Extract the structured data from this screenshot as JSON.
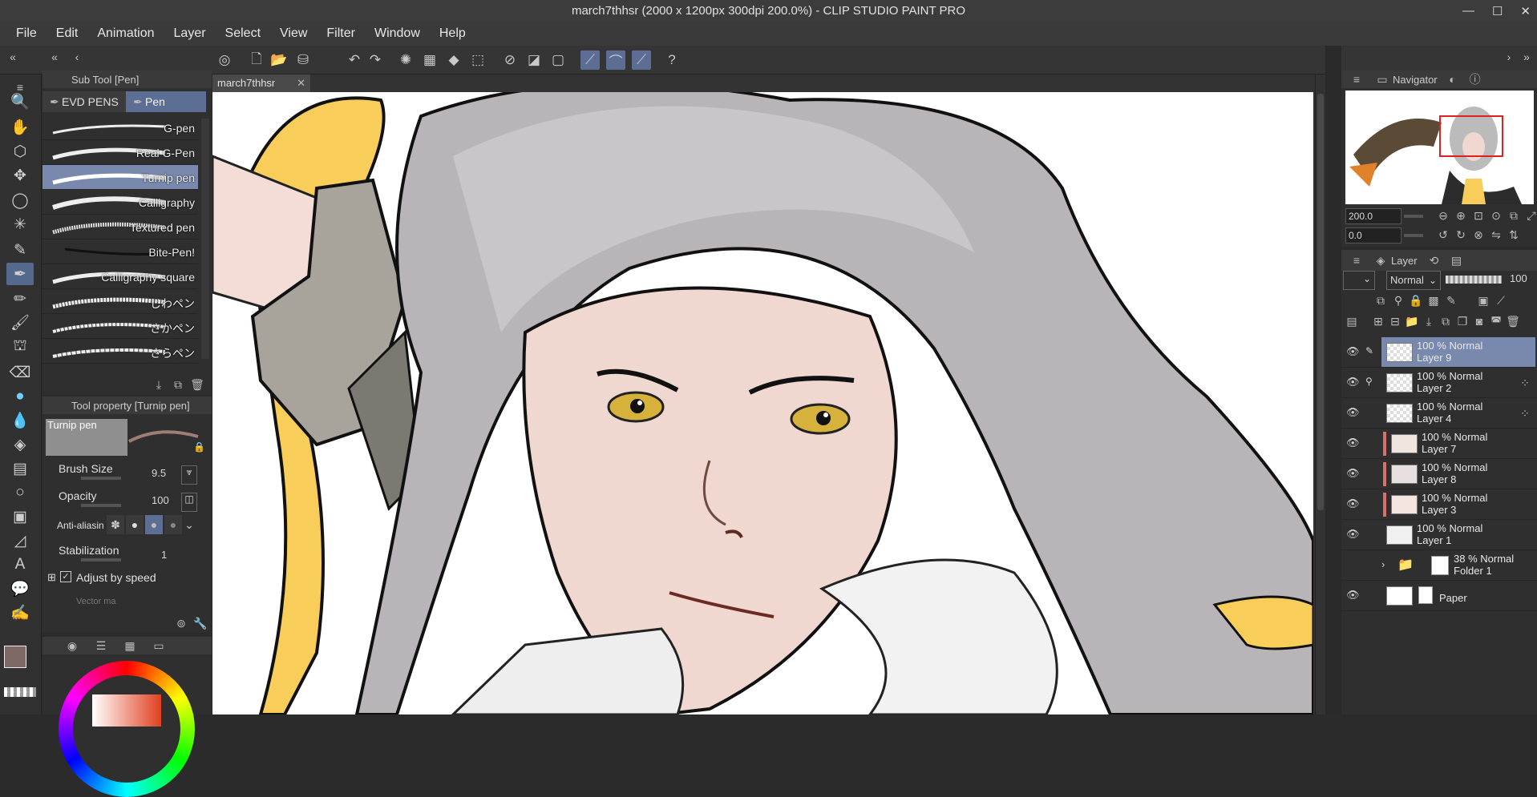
{
  "window": {
    "title": "march7thhsr (2000 x 1200px 300dpi 200.0%)  - CLIP STUDIO PAINT PRO"
  },
  "menu": [
    "File",
    "Edit",
    "Animation",
    "Layer",
    "Select",
    "View",
    "Filter",
    "Window",
    "Help"
  ],
  "document_tab": {
    "label": "march7thhsr"
  },
  "subtool": {
    "header": "Sub Tool [Pen]",
    "tabs": [
      "EVD PENS",
      "Pen"
    ],
    "brushes": [
      "G-pen",
      "Real G-Pen",
      "Turnip pen",
      "Calligraphy",
      "Textured pen",
      "Bite-Pen!",
      "Calligraphy square",
      "じわペン",
      "さかペン",
      "さらペン"
    ],
    "selected_brush": "Turnip pen"
  },
  "tool_property": {
    "header": "Tool property [Turnip pen]",
    "preview_label": "Turnip pen",
    "brush_size_label": "Brush Size",
    "brush_size_value": "9.5",
    "opacity_label": "Opacity",
    "opacity_value": "100",
    "antialias_label": "Anti-aliasin",
    "stabilization_label": "Stabilization",
    "stabilization_value": "1",
    "adjust_speed_label": "Adjust by speed",
    "vector_label": "Vector ma"
  },
  "navigator": {
    "header": "Navigator",
    "zoom_value": "200.0",
    "rotate_value": "0.0"
  },
  "layer_panel": {
    "header": "Layer",
    "blend_mode": "Normal",
    "opacity": "100",
    "layers": [
      {
        "opacity_mode": "100 % Normal",
        "name": "Layer 9"
      },
      {
        "opacity_mode": "100 % Normal",
        "name": "Layer 2"
      },
      {
        "opacity_mode": "100 % Normal",
        "name": "Layer 4"
      },
      {
        "opacity_mode": "100 % Normal",
        "name": "Layer 7"
      },
      {
        "opacity_mode": "100 % Normal",
        "name": "Layer 8"
      },
      {
        "opacity_mode": "100 % Normal",
        "name": "Layer 3"
      },
      {
        "opacity_mode": "100 % Normal",
        "name": "Layer 1"
      },
      {
        "opacity_mode": "38 % Normal",
        "name": "Folder 1"
      },
      {
        "opacity_mode": "",
        "name": "Paper"
      }
    ]
  },
  "colors": {
    "main_color": "#7d6866",
    "sub_color": "#ffffff",
    "accent": "#5c6e93",
    "selected_layer": "#7889ad"
  }
}
